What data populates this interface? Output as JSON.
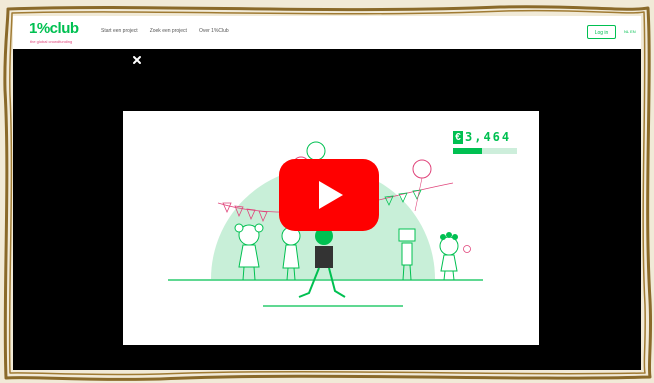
{
  "site": {
    "logo_text": "1%club",
    "tagline": "the global crowdfunding",
    "nav": [
      "Start een project",
      "Zoek een project",
      "Over 1%Club"
    ],
    "login_label": "Log in",
    "language": "NL EN"
  },
  "video": {
    "counter_currency": "€",
    "counter_value": "3,464",
    "progress": 0.45
  },
  "colors": {
    "brand_green": "#00c051",
    "overlay": "#000000",
    "play_red": "#ff0000",
    "accent_pink": "#e0437a",
    "mint": "#c8efd8"
  },
  "icons": {
    "close": "close-icon",
    "play": "play-icon"
  }
}
